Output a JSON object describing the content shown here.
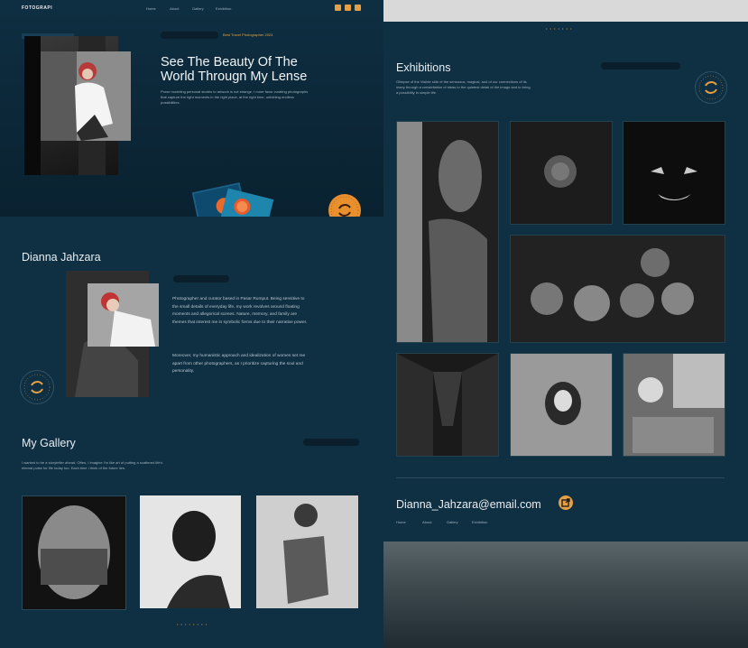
{
  "nav": {
    "logo": "FOTOGRAPI",
    "links": [
      "Home",
      "About",
      "Gallery",
      "Exhibition"
    ]
  },
  "social_icons": [
    "instagram-icon",
    "twitter-icon",
    "youtube-icon"
  ],
  "hero": {
    "badge": "Best Travel Photographer 2024",
    "title_line1": "See The Beauty Of The",
    "title_line2": "World Througn My Lense",
    "description": "Prose modeling personal stories to artwork is not strange, I more favor curating photographs that capture the right moments in the right place, at the right time, unfolding endless possibilities."
  },
  "contact_badge": {
    "label": "CONTACT · BY SNAP · TEAM ·"
  },
  "about": {
    "name": "Dianna Jahzara",
    "para1": "Photographer and curator based in Pasar Rumput. Being sensitive to the small details of everyday life, my work revolves around floating moments and allegorical scenes. Nature, memory, and family are themes that interest me in symbolic forms due to their narrative power.",
    "para2": "Moreover, my humanistic approach and idealization of women set me apart from other photographers, as I prioritize capturing the soul and personality."
  },
  "gallery": {
    "title": "My Gallery",
    "description": "I wanted to be a storyteller ahead. Often, I imagine I'm like art of putting a scattered life's eternal pulse for life today too. Each time I think of the future lies."
  },
  "exhibitions": {
    "title": "Exhibitions",
    "description": "Glimpse of the Visible side of the sensuous, magical, and of our connections of its many through a constellation of ideas to the quietest detail of the image and to bring a possibility in simple life."
  },
  "footer": {
    "email": "Dianna_Jahzara@email.com",
    "links": [
      "Home",
      "About",
      "Gallery",
      "Exhibition"
    ]
  },
  "colors": {
    "accent": "#e6a043",
    "background": "#0f2f42"
  }
}
